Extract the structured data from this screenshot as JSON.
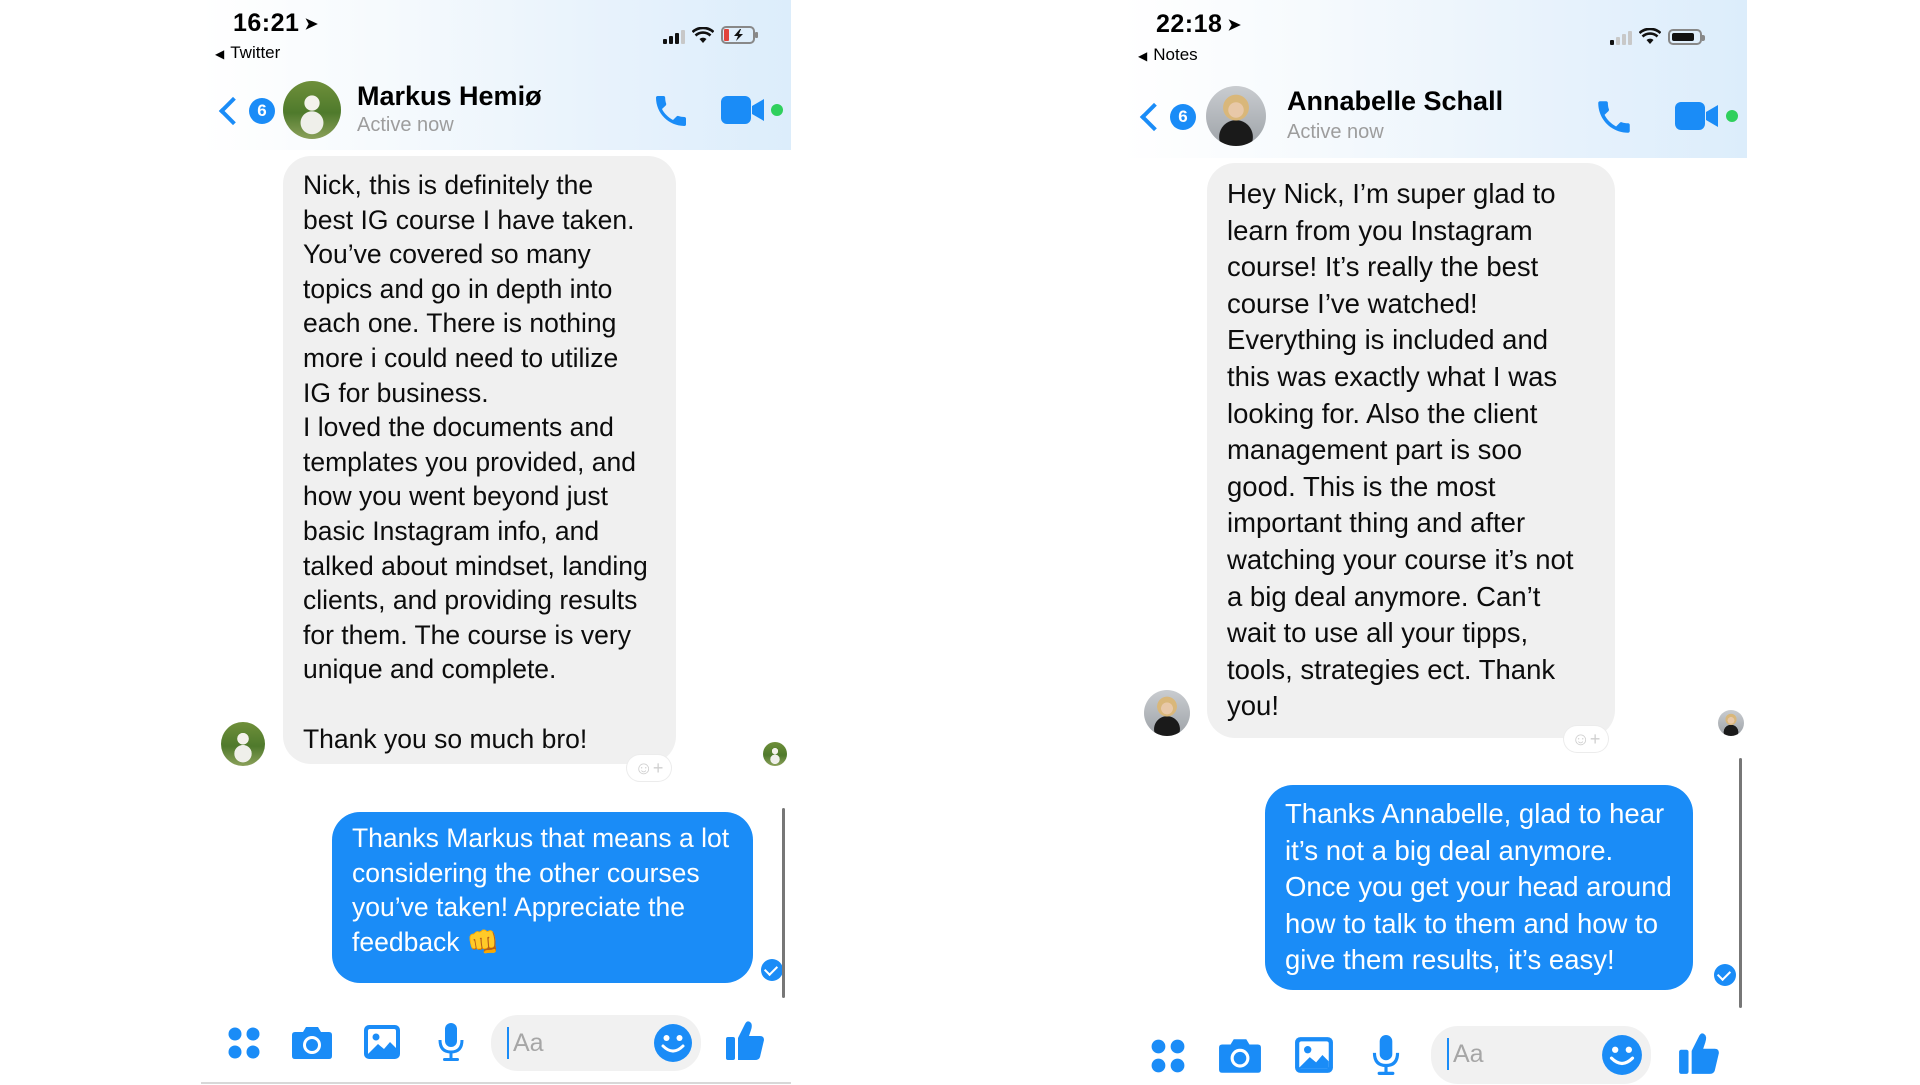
{
  "screens": [
    {
      "status": {
        "time": "16:21",
        "back_app": "Twitter",
        "signal_bars": 3,
        "battery_charging": true
      },
      "header": {
        "back_count": "6",
        "contact_name": "Markus Hemiø",
        "contact_status": "Active now"
      },
      "received": {
        "text": "Nick, this is definitely the\nbest IG course I have taken.\nYou’ve covered so many\ntopics and go in depth into\neach one. There is nothing\nmore i could need to utilize\nIG for business.\nI loved the documents and\ntemplates you provided, and\nhow you went beyond just\nbasic Instagram info, and\ntalked about mindset, landing\nclients, and providing results\nfor them. The course is very\nunique and complete.\n\nThank you so much bro!"
      },
      "sent": {
        "text": "Thanks Markus that means a lot\nconsidering the other courses\nyou’ve taken! Appreciate the\nfeedback 👊"
      },
      "composer": {
        "placeholder": "Aa"
      }
    },
    {
      "status": {
        "time": "22:18",
        "back_app": "Notes",
        "signal_bars": 1,
        "battery_charging": false
      },
      "header": {
        "back_count": "6",
        "contact_name": "Annabelle Schall",
        "contact_status": "Active now"
      },
      "received": {
        "text": "Hey Nick, I’m super glad to\nlearn from you Instagram\ncourse! It’s really the best\ncourse I’ve watched!\nEverything is included and\nthis was exactly what I was\nlooking for. Also the client\nmanagement part is soo\ngood. This is the most\nimportant thing and after\nwatching your course it’s not\na big deal anymore. Can’t\nwait to use all your tipps,\ntools, strategies ect. Thank\nyou!"
      },
      "sent": {
        "text": "Thanks Annabelle, glad to hear\nit’s not a big deal anymore.\nOnce you get your head around\nhow to talk to them and how to\ngive them results, it’s easy!"
      },
      "composer": {
        "placeholder": "Aa"
      }
    }
  ],
  "colors": {
    "accent": "#1a8cf7",
    "received_bubble": "#f0f0f0",
    "active_dot": "#2fd05c"
  }
}
